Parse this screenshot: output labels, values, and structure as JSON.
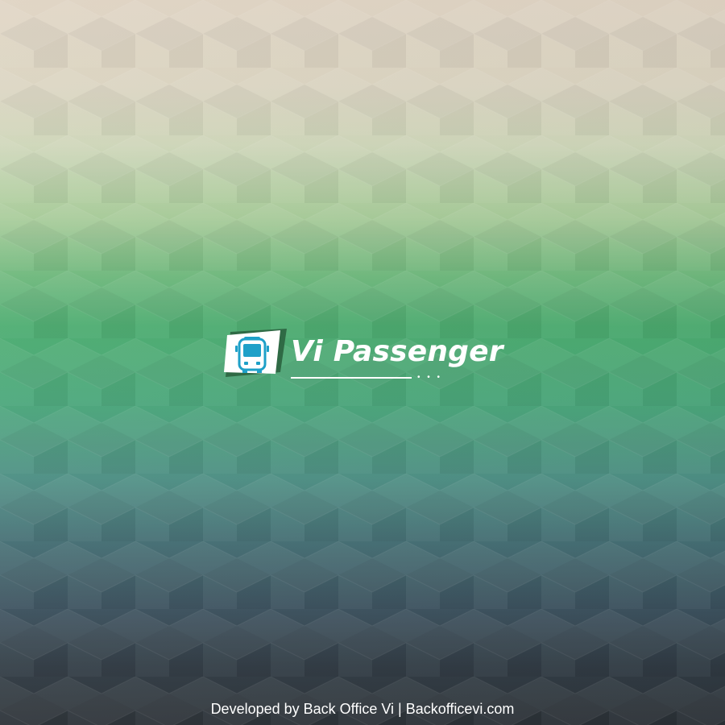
{
  "app": {
    "name": "Vi Passenger",
    "logo_icon": "bus-icon",
    "logo_dots": "• • •"
  },
  "footer": {
    "text": "Developed by Back Office Vi | Backofficevi.com"
  },
  "colors": {
    "top": "#dfd3c2",
    "middle": "#4aad6f",
    "bottom": "#2c3238",
    "accent": "#1ea0c8",
    "logo_shadow": "#2f6a45"
  }
}
